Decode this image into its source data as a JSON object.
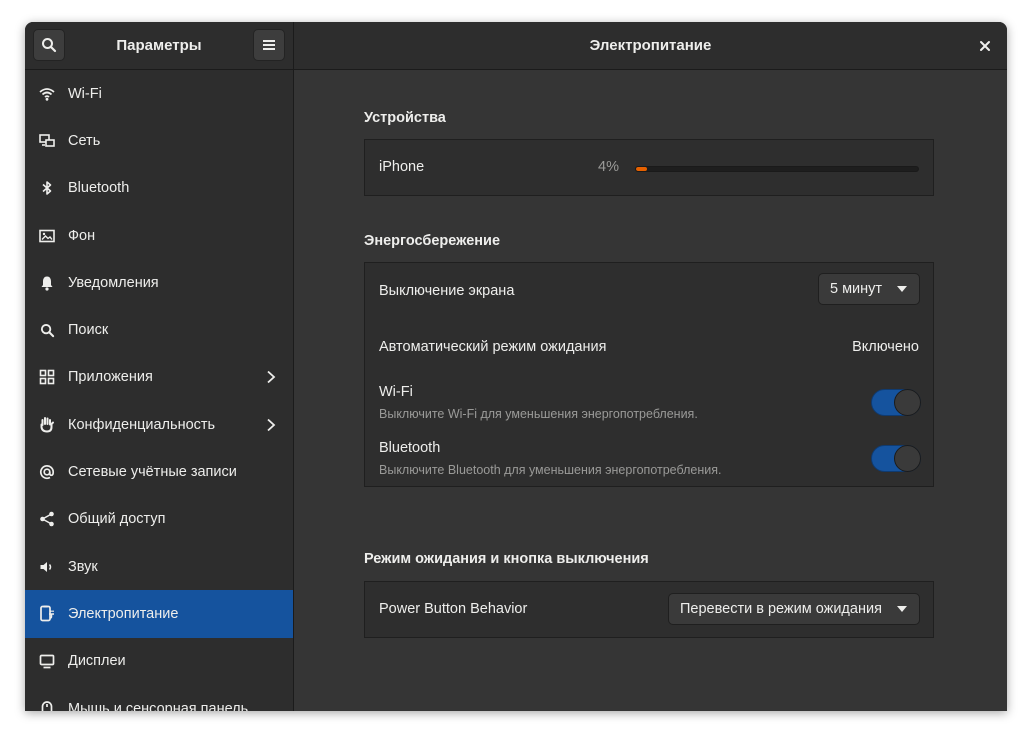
{
  "header": {
    "left_title": "Параметры",
    "main_title": "Электропитание"
  },
  "sidebar": {
    "items": [
      {
        "label": "Wi-Fi",
        "icon": "wifi-icon"
      },
      {
        "label": "Сеть",
        "icon": "network-icon"
      },
      {
        "label": "Bluetooth",
        "icon": "bluetooth-icon"
      },
      {
        "label": "Фон",
        "icon": "background-icon"
      },
      {
        "label": "Уведомления",
        "icon": "bell-icon"
      },
      {
        "label": "Поиск",
        "icon": "search-icon"
      },
      {
        "label": "Приложения",
        "icon": "apps-grid-icon"
      },
      {
        "label": "Конфиденциальность",
        "icon": "hand-icon"
      },
      {
        "label": "Сетевые учётные записи",
        "icon": "at-icon"
      },
      {
        "label": "Общий доступ",
        "icon": "share-icon"
      },
      {
        "label": "Звук",
        "icon": "speaker-icon"
      },
      {
        "label": "Электропитание",
        "icon": "power-icon"
      },
      {
        "label": "Дисплеи",
        "icon": "display-icon"
      },
      {
        "label": "Мышь и сенсорная панель",
        "icon": "mouse-icon"
      }
    ]
  },
  "devices": {
    "title": "Устройства",
    "device_name": "iPhone",
    "percent_label": "4%",
    "level_fraction": 0.04
  },
  "power_saving": {
    "title": "Энергосбережение",
    "screen_off_label": "Выключение экрана",
    "screen_off_value": "5 минут",
    "auto_suspend_label": "Автоматический режим ожидания",
    "auto_suspend_value": "Включено",
    "wifi_label": "Wi-Fi",
    "wifi_desc": "Выключите Wi-Fi для уменьшения энергопотребления.",
    "wifi_on": true,
    "bt_label": "Bluetooth",
    "bt_desc": "Выключите Bluetooth для уменьшения энергопотребления.",
    "bt_on": true
  },
  "suspend_button": {
    "title": "Режим ожидания и кнопка выключения",
    "power_button_label": "Power Button Behavior",
    "power_button_value": "Перевести в режим ожидания"
  },
  "colors": {
    "accent": "#15539e",
    "battery_low": "#e66100"
  }
}
